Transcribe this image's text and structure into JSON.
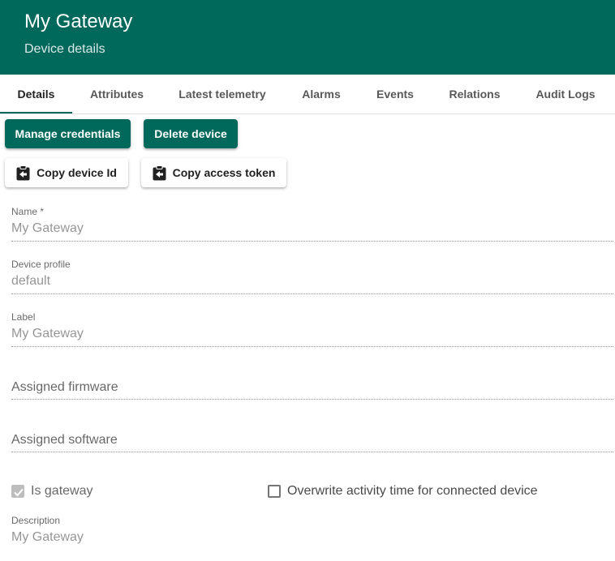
{
  "header": {
    "title": "My Gateway",
    "subtitle": "Device details",
    "background": "#00695c"
  },
  "tabs": [
    {
      "label": "Details",
      "active": true
    },
    {
      "label": "Attributes"
    },
    {
      "label": "Latest telemetry"
    },
    {
      "label": "Alarms"
    },
    {
      "label": "Events"
    },
    {
      "label": "Relations"
    },
    {
      "label": "Audit Logs"
    }
  ],
  "actions": {
    "manage_credentials": "Manage credentials",
    "delete_device": "Delete device",
    "copy_device_id": "Copy device Id",
    "copy_access_token": "Copy access token",
    "copy_icon": "clipboard-arrow-left-icon"
  },
  "form": {
    "name": {
      "label": "Name *",
      "value": "My Gateway"
    },
    "device_profile": {
      "label": "Device profile",
      "value": "default"
    },
    "label": {
      "label": "Label",
      "value": "My Gateway"
    },
    "assigned_firmware": {
      "placeholder": "Assigned firmware"
    },
    "assigned_software": {
      "placeholder": "Assigned software"
    },
    "is_gateway": {
      "label": "Is gateway",
      "checked": true,
      "disabled": true
    },
    "overwrite_activity": {
      "label": "Overwrite activity time for connected device",
      "checked": false
    },
    "description": {
      "label": "Description",
      "value": "My Gateway"
    }
  }
}
